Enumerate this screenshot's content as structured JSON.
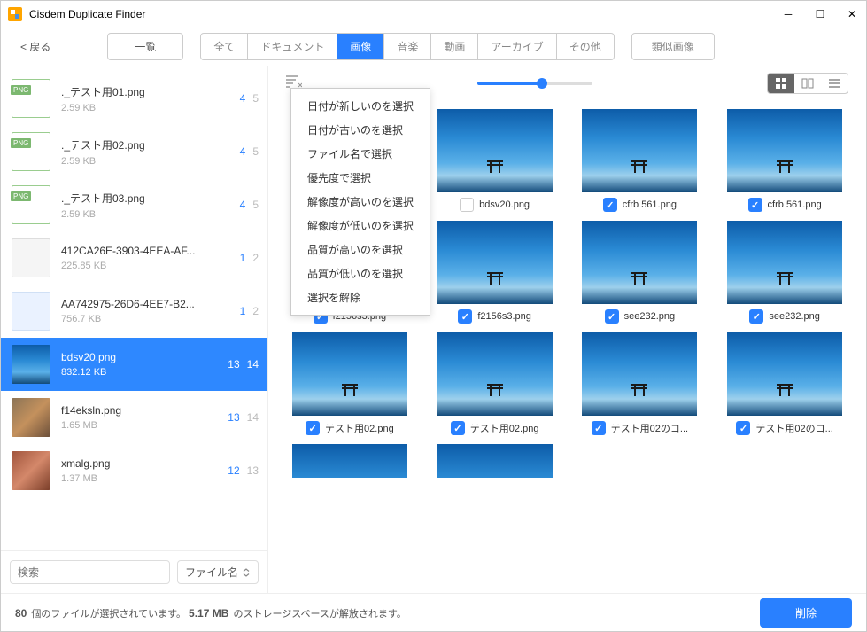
{
  "window": {
    "title": "Cisdem Duplicate Finder"
  },
  "toolbar": {
    "back": "< 戻る",
    "overview": "一覧",
    "tabs": [
      "全て",
      "ドキュメント",
      "画像",
      "音楽",
      "動画",
      "アーカイブ",
      "その他"
    ],
    "activeTab": 2,
    "similar": "類似画像"
  },
  "sidebar": {
    "items": [
      {
        "name": "._テスト用01.png",
        "size": "2.59 KB",
        "c1": "4",
        "c2": "5",
        "thumb": "png"
      },
      {
        "name": "._テスト用02.png",
        "size": "2.59 KB",
        "c1": "4",
        "c2": "5",
        "thumb": "png"
      },
      {
        "name": "._テスト用03.png",
        "size": "2.59 KB",
        "c1": "4",
        "c2": "5",
        "thumb": "png"
      },
      {
        "name": "412CA26E-3903-4EEA-AF...",
        "size": "225.85 KB",
        "c1": "1",
        "c2": "2",
        "thumb": "doc"
      },
      {
        "name": "AA742975-26D6-4EE7-B2...",
        "size": "756.7 KB",
        "c1": "1",
        "c2": "2",
        "thumb": "file"
      },
      {
        "name": "bdsv20.png",
        "size": "832.12 KB",
        "c1": "13",
        "c2": "14",
        "thumb": "img",
        "selected": true
      },
      {
        "name": "f14eksln.png",
        "size": "1.65 MB",
        "c1": "13",
        "c2": "14",
        "thumb": "photo"
      },
      {
        "name": "xmalg.png",
        "size": "1.37 MB",
        "c1": "12",
        "c2": "13",
        "thumb": "photo2"
      }
    ],
    "search": "検索",
    "sort": "ファイル名"
  },
  "dropdown": [
    "日付が新しいのを選択",
    "日付が古いのを選択",
    "ファイル名で選択",
    "優先度で選択",
    "解像度が高いのを選択",
    "解像度が低いのを選択",
    "品質が高いのを選択",
    "品質が低いのを選択",
    "選択を解除"
  ],
  "grid": [
    {
      "name": "bdsv20.png",
      "checked": false
    },
    {
      "name": "bdsv20.png",
      "checked": false
    },
    {
      "name": "cfrb 561.png",
      "checked": true
    },
    {
      "name": "cfrb 561.png",
      "checked": true
    },
    {
      "name": "f2156s3.png",
      "checked": true
    },
    {
      "name": "f2156s3.png",
      "checked": true
    },
    {
      "name": "see232.png",
      "checked": true
    },
    {
      "name": "see232.png",
      "checked": true
    },
    {
      "name": "テスト用02.png",
      "checked": true
    },
    {
      "name": "テスト用02.png",
      "checked": true
    },
    {
      "name": "テスト用02のコ...",
      "checked": true
    },
    {
      "name": "テスト用02のコ...",
      "checked": true
    }
  ],
  "status": {
    "count": "80",
    "text1": " 個のファイルが選択されています。 ",
    "size": "5.17 MB",
    "text2": " のストレージスペースが解放されます。",
    "delete": "削除"
  }
}
